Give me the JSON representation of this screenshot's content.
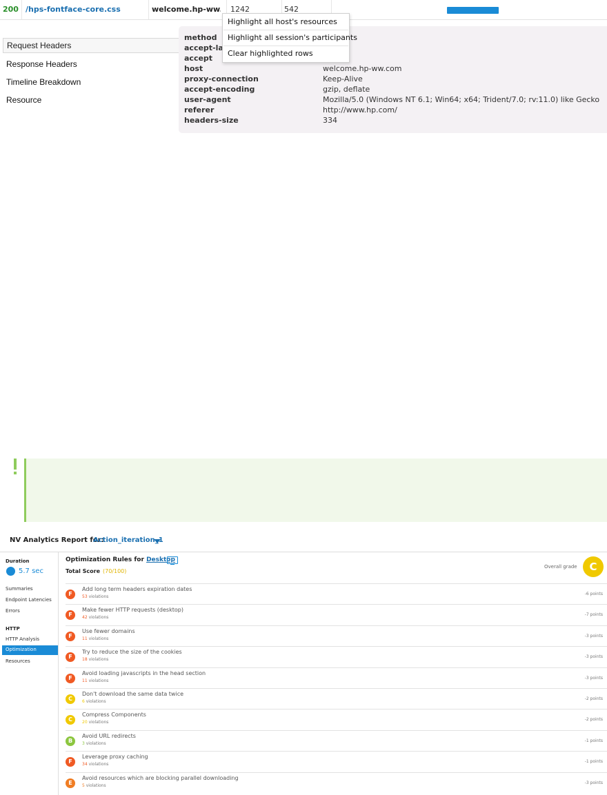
{
  "request_row": {
    "status": "200",
    "url": "/hps-fontface-core.css",
    "host": "welcome.hp-ww...",
    "size1": "1242",
    "size2": "542",
    "bar_color": "#1a8bd6"
  },
  "context_menu": {
    "items": [
      "Highlight all host's resources",
      "Highlight all session's participants",
      "Clear highlighted rows"
    ]
  },
  "left_nav": {
    "items": [
      "Request Headers",
      "Response Headers",
      "Timeline Breakdown",
      "Resource"
    ]
  },
  "headers": [
    {
      "key": "method",
      "value": ""
    },
    {
      "key": "accept-lang",
      "value": ""
    },
    {
      "key": "accept",
      "value": ""
    },
    {
      "key": "host",
      "value": "welcome.hp-ww.com"
    },
    {
      "key": "proxy-connection",
      "value": "Keep-Alive"
    },
    {
      "key": "accept-encoding",
      "value": "gzip, deflate"
    },
    {
      "key": "user-agent",
      "value": "Mozilla/5.0 (Windows NT 6.1; Win64; x64; Trident/7.0; rv:11.0) like Gecko"
    },
    {
      "key": "referer",
      "value": "http://www.hp.com/"
    },
    {
      "key": "headers-size",
      "value": "334"
    }
  ],
  "report": {
    "title": "NV Analytics Report for:",
    "iteration": "Action_iteration_1",
    "sidebar": {
      "duration_label": "Duration",
      "duration_value": "5.7 sec",
      "items_group1": [
        "Summaries",
        "Endpoint Latencies",
        "Errors"
      ],
      "http_label": "HTTP",
      "items_group2": [
        "HTTP Analysis",
        "Optimization",
        "Resources"
      ]
    },
    "main": {
      "title_prefix": "Optimization Rules for",
      "title_link": "Desktop",
      "total_label": "Total Score",
      "total_value": "(70/100)",
      "overall_label": "Overall grade",
      "overall_grade": "C",
      "grade_colors": {
        "F": "#f05a23",
        "C": "#f0c900",
        "B": "#8cc63f",
        "E": "#f07d23"
      },
      "rules": [
        {
          "grade": "F",
          "title": "Add long term headers expiration dates",
          "violations": "53",
          "vlabel": "violations",
          "points": "-6 points"
        },
        {
          "grade": "F",
          "title": "Make fewer HTTP requests (desktop)",
          "violations": "42",
          "vlabel": "violations",
          "points": "-7 points"
        },
        {
          "grade": "F",
          "title": "Use fewer domains",
          "violations": "11",
          "vlabel": "violations",
          "points": "-3 points"
        },
        {
          "grade": "F",
          "title": "Try to reduce the size of the cookies",
          "violations": "18",
          "vlabel": "violations",
          "points": "-3 points"
        },
        {
          "grade": "F",
          "title": "Avoid loading javascripts in the head section",
          "violations": "11",
          "vlabel": "violations",
          "points": "-3 points"
        },
        {
          "grade": "C",
          "title": "Don't download the same data twice",
          "violations": "6",
          "vlabel": "violations",
          "points": "-2 points"
        },
        {
          "grade": "C",
          "title": "Compress Components",
          "violations": "20",
          "vlabel": "violations",
          "points": "-2 points"
        },
        {
          "grade": "B",
          "title": "Avoid URL redirects",
          "violations": "3",
          "vlabel": "violations",
          "points": "-1 points"
        },
        {
          "grade": "F",
          "title": "Leverage proxy caching",
          "violations": "34",
          "vlabel": "violations",
          "points": "-1 points"
        },
        {
          "grade": "E",
          "title": "Avoid resources which are blocking parallel downloading",
          "violations": "5",
          "vlabel": "violations",
          "points": "-3 points"
        }
      ]
    }
  }
}
